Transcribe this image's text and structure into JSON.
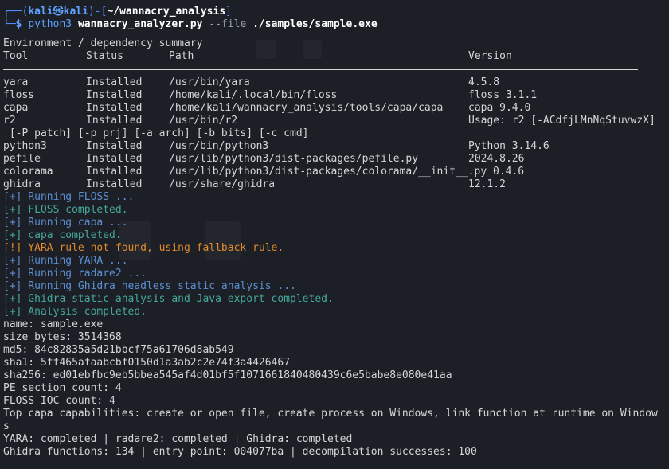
{
  "prompt": {
    "corner_top": "┌──(",
    "user": "kali",
    "at": "㉿",
    "host": "kali",
    "sep": ")-[",
    "path": "~/wannacry_analysis",
    "close": "]",
    "corner_bottom": "└─",
    "dollar": "$ ",
    "cmd": "python3",
    "script": "wannacry_analyzer.py",
    "flag": "--file",
    "file": "./samples/sample.exe"
  },
  "env": {
    "title": "Environment / dependency summary",
    "headers": [
      "Tool",
      "Status",
      "Path",
      "Version"
    ],
    "rows": [
      [
        "yara",
        "Installed",
        "/usr/bin/yara",
        "4.5.8"
      ],
      [
        "floss",
        "Installed",
        "/home/kali/.local/bin/floss",
        "floss 3.1.1"
      ],
      [
        "capa",
        "Installed",
        "/home/kali/wannacry_analysis/tools/capa/capa",
        "capa 9.4.0"
      ],
      [
        "r2",
        "Installed",
        "/usr/bin/r2",
        "Usage: r2 [-ACdfjLMnNqStuvwzX]"
      ]
    ],
    "wrap": " [-P patch] [-p prj] [-a arch] [-b bits] [-c cmd]",
    "rows2": [
      [
        "python3",
        "Installed",
        "/usr/bin/python3",
        "Python 3.14.6"
      ],
      [
        "pefile",
        "Installed",
        "/usr/lib/python3/dist-packages/pefile.py",
        "2024.8.26"
      ],
      [
        "colorama",
        "Installed",
        "/usr/lib/python3/dist-packages/colorama/__init__.py 0.4.6",
        ""
      ],
      [
        "ghidra",
        "Installed",
        "/usr/share/ghidra",
        "12.1.2"
      ]
    ]
  },
  "log": [
    {
      "text": "[+] Running FLOSS ...",
      "kind": "info"
    },
    {
      "text": "[+] FLOSS completed.",
      "kind": "ok"
    },
    {
      "text": "[+] Running capa ...",
      "kind": "info"
    },
    {
      "text": "[+] capa completed.",
      "kind": "ok"
    },
    {
      "text": "[!] YARA rule not found, using fallback rule.",
      "kind": "warn"
    },
    {
      "text": "[+] Running YARA ...",
      "kind": "info"
    },
    {
      "text": "[+] Running radare2 ...",
      "kind": "info"
    },
    {
      "text": "[+] Running Ghidra headless static analysis ...",
      "kind": "info"
    },
    {
      "text": "[+] Ghidra static analysis and Java export completed.",
      "kind": "ok"
    },
    {
      "text": "[+] Analysis completed.",
      "kind": "ok"
    }
  ],
  "summary": {
    "name": "name: sample.exe",
    "size": "size_bytes: 3514368",
    "md5": "md5: 84c82835a5d21bbcf75a61706d8ab549",
    "sha1": "sha1: 5ff465afaabcbf0150d1a3ab2c2e74f3a4426467",
    "sha256": "sha256: ed01ebfbc9eb5bbea545af4d01bf5f1071661840480439c6e5babe8e080e41aa",
    "pe": "PE section count: 4",
    "floss": "FLOSS IOC count: 4",
    "capa": "Top capa capabilities: create or open file, create process on Windows, link function at runtime on Windows",
    "status": "YARA: completed | radare2: completed | Ghidra: completed",
    "ghidra": "Ghidra functions: 134 | entry point: 004077ba | decompilation successes: 100"
  },
  "colors": {
    "background": "#1c1f26",
    "prompt_blue": "#4f8ef7",
    "info": "#5c8fd1",
    "success": "#45a89a",
    "warning": "#e08a2b"
  }
}
